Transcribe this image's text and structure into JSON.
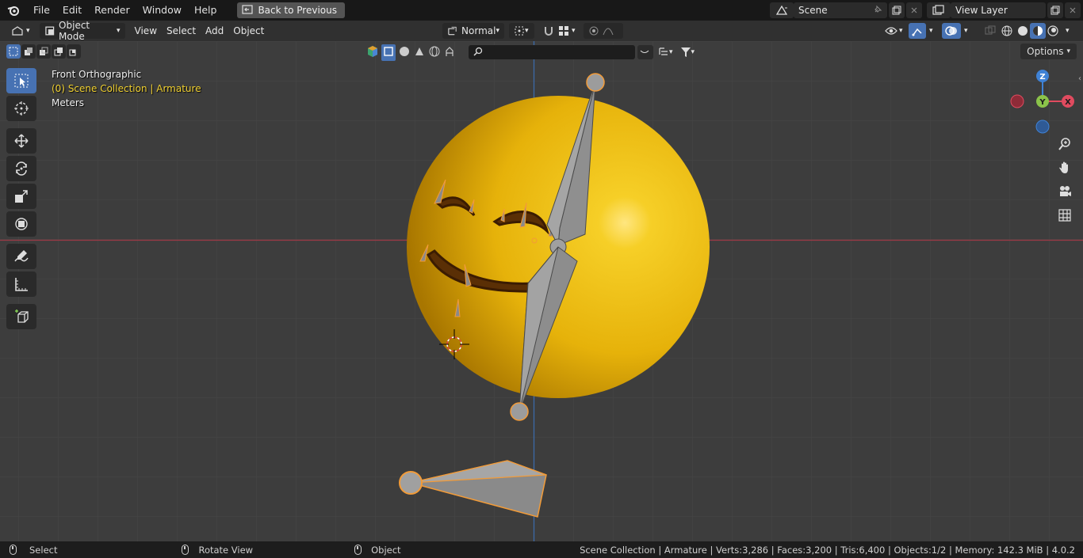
{
  "menubar": {
    "items": [
      "File",
      "Edit",
      "Render",
      "Window",
      "Help"
    ],
    "back_button": "Back to Previous"
  },
  "scene": {
    "name": "Scene"
  },
  "view_layer": {
    "name": "View Layer"
  },
  "header": {
    "mode": "Object Mode",
    "menus": [
      "View",
      "Select",
      "Add",
      "Object"
    ],
    "transform_orientation": "Normal",
    "options_label": "Options"
  },
  "viewport": {
    "view_name": "Front Orthographic",
    "collection_info": "(0) Scene Collection | Armature",
    "units": "Meters"
  },
  "gizmo": {
    "z": "Z",
    "y": "Y",
    "x": "X"
  },
  "statusbar": {
    "select": "Select",
    "rotate": "Rotate View",
    "object": "Object",
    "stats": "Scene Collection | Armature | Verts:3,286 | Faces:3,200 | Tris:6,400 | Objects:1/2 | Memory: 142.3 MiB | 4.0.2"
  },
  "colors": {
    "accent_blue": "#4772b3",
    "sphere_yellow": "#f2c20f",
    "selection_orange": "#f29b38",
    "x_axis": "#e04b5f",
    "y_axis": "#8bc34a",
    "z_axis": "#3f82d6"
  }
}
